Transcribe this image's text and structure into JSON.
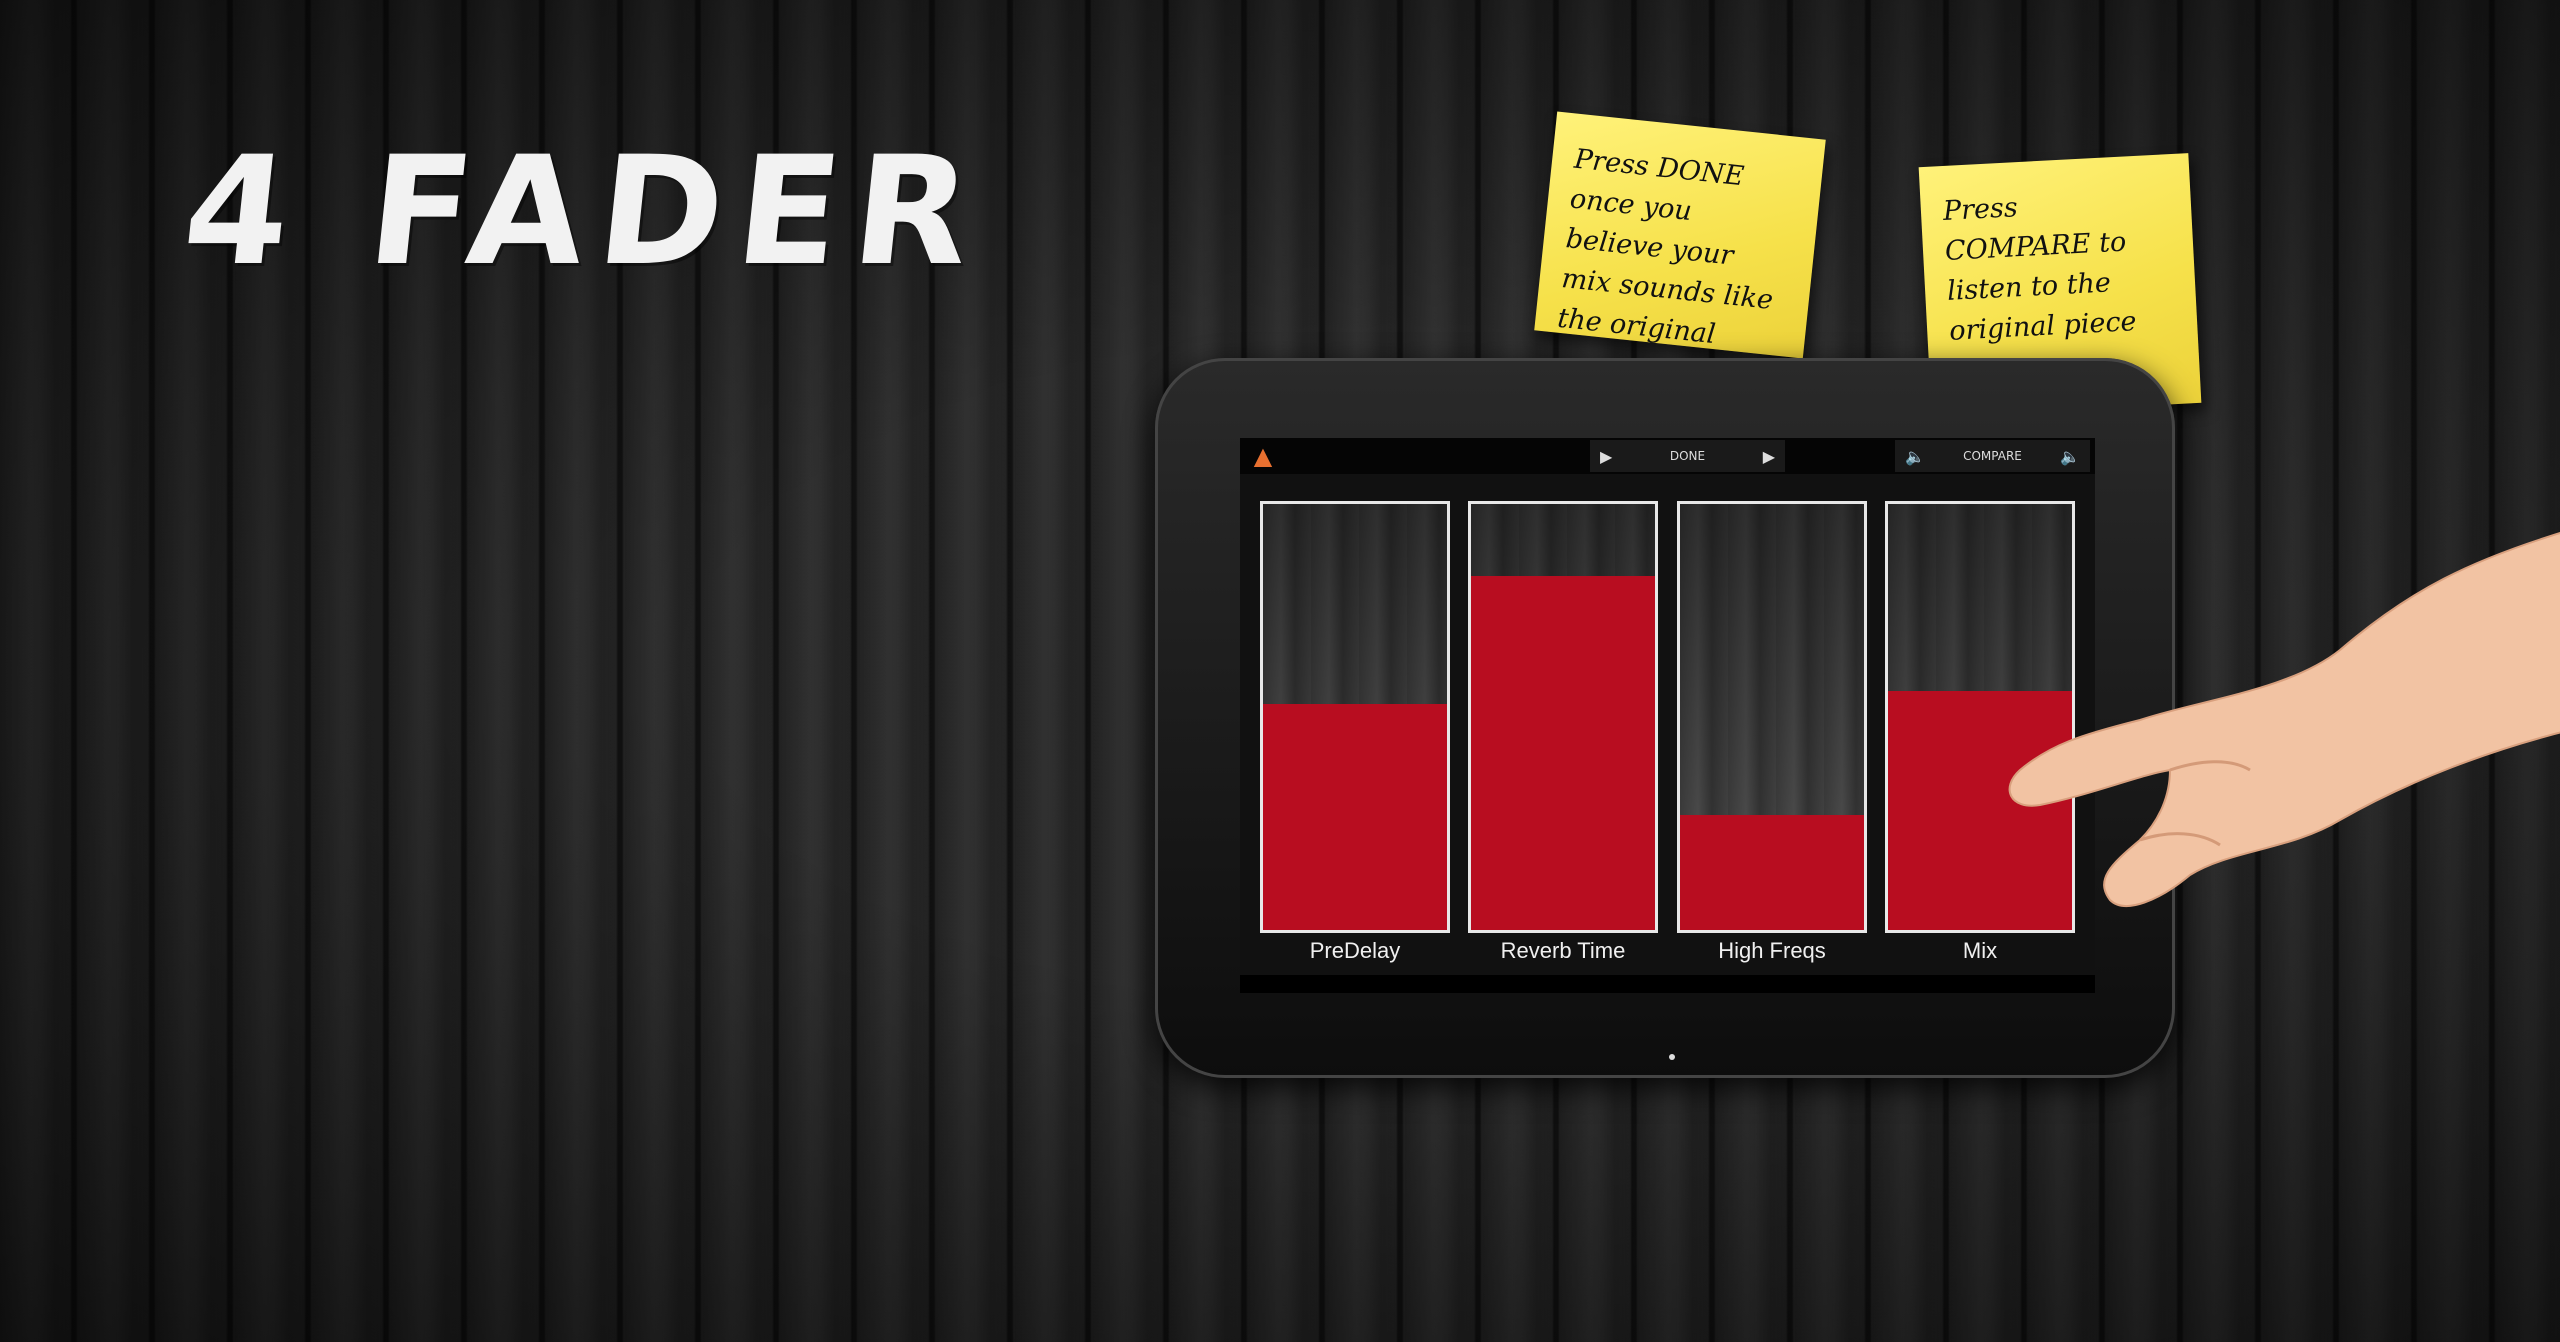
{
  "hero": {
    "title": "4 FADER"
  },
  "notes": [
    {
      "text": "Press DONE once you believe your mix sounds like the original"
    },
    {
      "text": "Press COMPARE to listen to the original piece"
    }
  ],
  "toolbar": {
    "done_label": "DONE",
    "compare_label": "COMPARE",
    "logo_icon": "app-logo-icon",
    "play_icon": "play-arrow-icon",
    "speaker_icon": "speaker-icon"
  },
  "faders": [
    {
      "label": "PreDelay",
      "level": 0.53
    },
    {
      "label": "Reverb Time",
      "level": 0.83
    },
    {
      "label": "High Freqs",
      "level": 0.27
    },
    {
      "label": "Mix",
      "level": 0.56
    }
  ],
  "colors": {
    "fader_fill": "#b80d20",
    "note_yellow": "#f6e14a"
  }
}
